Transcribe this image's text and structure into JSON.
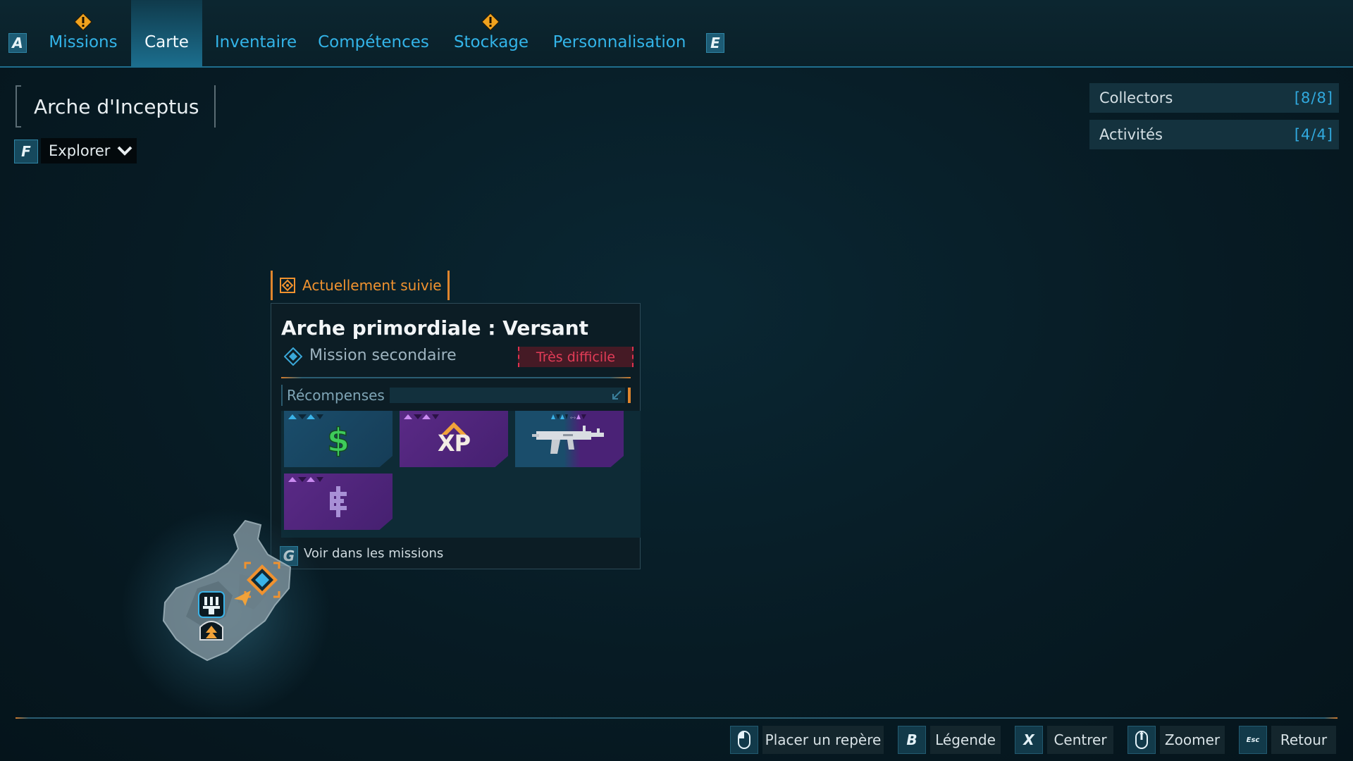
{
  "nav": {
    "left_key": "A",
    "right_key": "E",
    "tabs": [
      {
        "label": "Missions",
        "active": false,
        "alert": true
      },
      {
        "label": "Carte",
        "active": true,
        "alert": false
      },
      {
        "label": "Inventaire",
        "active": false,
        "alert": false
      },
      {
        "label": "Compétences",
        "active": false,
        "alert": false
      },
      {
        "label": "Stockage",
        "active": false,
        "alert": true
      },
      {
        "label": "Personnalisation",
        "active": false,
        "alert": false
      }
    ]
  },
  "location": {
    "name": "Arche d'Inceptus",
    "filter_key": "F",
    "filter_label": "Explorer"
  },
  "counters": [
    {
      "label": "Collectors",
      "value": "[8/8]"
    },
    {
      "label": "Activités",
      "value": "[4/4]"
    }
  ],
  "mission": {
    "tracked_label": "Actuellement suivie",
    "title": "Arche primordiale : Versant",
    "type": "Mission secondaire",
    "difficulty": "Très difficile",
    "rewards_label": "Récompenses",
    "rewards": [
      {
        "icon": "cash-icon",
        "rarity": "blue",
        "text": ""
      },
      {
        "icon": "xp-icon",
        "rarity": "purple",
        "text": "XP"
      },
      {
        "icon": "smg-weapon-icon",
        "rarity": "mixed",
        "text": ""
      },
      {
        "icon": "eridium-icon",
        "rarity": "purple",
        "text": ""
      }
    ],
    "view_key": "G",
    "view_label": "Voir dans les missions"
  },
  "hints": [
    {
      "key_icon": "mouse-left-icon",
      "key": "",
      "label": "Placer un repère"
    },
    {
      "key_icon": "key-b-icon",
      "key": "B",
      "label": "Légende"
    },
    {
      "key_icon": "key-x-icon",
      "key": "X",
      "label": "Centrer"
    },
    {
      "key_icon": "mouse-wheel-icon",
      "key": "",
      "label": "Zoomer"
    },
    {
      "key_icon": "key-esc-icon",
      "key": "Esc",
      "label": "Retour"
    }
  ],
  "colors": {
    "accent_blue": "#33b4e8",
    "tracked_orange": "#f0922f",
    "danger_red": "#e23c57",
    "rarity_blue": "#1a4d6b",
    "rarity_purple": "#5a2a86"
  }
}
